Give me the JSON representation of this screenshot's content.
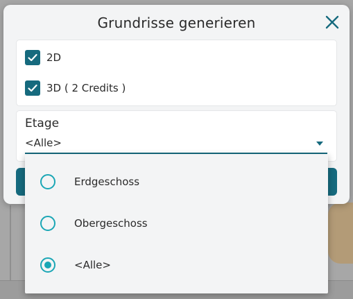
{
  "dialog": {
    "title": "Grundrisse generieren",
    "close_icon": "close-icon"
  },
  "options": {
    "items": [
      {
        "label": "2D",
        "checked": true
      },
      {
        "label": "3D ( 2 Credits )",
        "checked": true
      }
    ]
  },
  "etage": {
    "label": "Etage",
    "value": "<Alle>"
  },
  "dropdown": {
    "items": [
      {
        "label": "Erdgeschoss",
        "selected": false
      },
      {
        "label": "Obergeschoss",
        "selected": false
      },
      {
        "label": "<Alle>",
        "selected": true
      }
    ]
  },
  "colors": {
    "accent": "#166a7e",
    "radio": "#1aa6b5"
  }
}
